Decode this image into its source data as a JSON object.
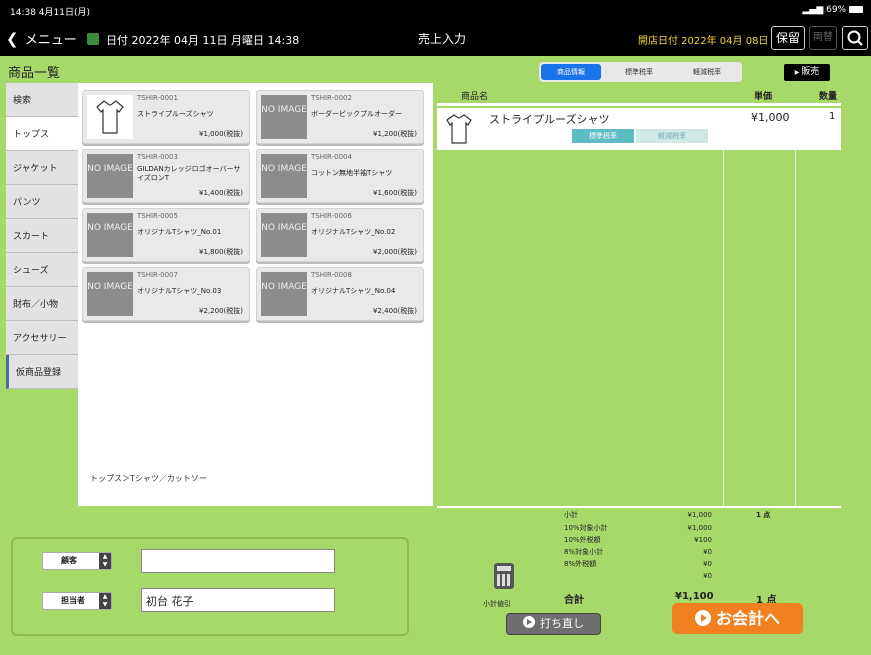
{
  "status": {
    "time": "14:38  4月11日(月)",
    "battery": "69%"
  },
  "nav": {
    "back_label": "メニュー",
    "date_label": "日付 2022年 04月 11日 月曜日 14:38",
    "title": "売上入力",
    "open_date": "開店日付 2022年 04月 08日",
    "hold_label": "保留",
    "exchange_label": "両替"
  },
  "product_list_title": "商品一覧",
  "categories": [
    "検索",
    "トップス",
    "ジャケット",
    "パンツ",
    "スカート",
    "シューズ",
    "財布／小物",
    "アクセサリー",
    "仮商品登録"
  ],
  "no_image": "NO IMAGE",
  "products": [
    {
      "code": "TSHIR-0001",
      "name": "ストライプルーズシャツ",
      "price": "¥1,000(税抜)"
    },
    {
      "code": "TSHIR-0002",
      "name": "ボーダービックプルオーダー",
      "price": "¥1,200(税抜)"
    },
    {
      "code": "TSHIR-0003",
      "name": "GILDANカレッジロゴオーバーサイズロンT",
      "price": "¥1,400(税抜)"
    },
    {
      "code": "TSHIR-0004",
      "name": "コットン無地半袖Tシャツ",
      "price": "¥1,600(税抜)"
    },
    {
      "code": "TSHIR-0005",
      "name": "オリジナルTシャツ_No.01",
      "price": "¥1,800(税抜)"
    },
    {
      "code": "TSHIR-0006",
      "name": "オリジナルTシャツ_No.02",
      "price": "¥2,000(税抜)"
    },
    {
      "code": "TSHIR-0007",
      "name": "オリジナルTシャツ_No.03",
      "price": "¥2,200(税抜)"
    },
    {
      "code": "TSHIR-0008",
      "name": "オリジナルTシャツ_No.04",
      "price": "¥2,400(税抜)"
    }
  ],
  "breadcrumb": "トップス＞Tシャツ／カットソー",
  "tabs": [
    "商品情報",
    "標準税率",
    "軽減税率"
  ],
  "sell_label": "販売",
  "sales": {
    "headers": {
      "name": "商品名",
      "unit_price": "単価",
      "qty": "数量"
    },
    "rows": [
      {
        "name": "ストライプルーズシャツ",
        "price": "¥1,000",
        "qty": "1",
        "tax_standard": "標準税率",
        "tax_reduced": "軽減税率"
      }
    ]
  },
  "summary": {
    "lines": [
      {
        "label": "小計",
        "value": "¥1,000",
        "count": "1 点"
      },
      {
        "label": "10%対象小計",
        "value": "¥1,000"
      },
      {
        "label": "10%外税額",
        "value": "¥100"
      },
      {
        "label": "8%対象小計",
        "value": "¥0"
      },
      {
        "label": "8%外税額",
        "value": "¥0"
      },
      {
        "label": "",
        "value": "¥0"
      }
    ],
    "total_label": "合計",
    "total_value": "¥1,100",
    "total_count": "1 点"
  },
  "subtotal_discount_label": "小計値引",
  "redo_label": "打ち直し",
  "checkout_label": "お会計へ",
  "customer": {
    "customer_label": "顧客",
    "staff_label": "担当者",
    "customer_value": "",
    "staff_value": "初台 花子"
  }
}
